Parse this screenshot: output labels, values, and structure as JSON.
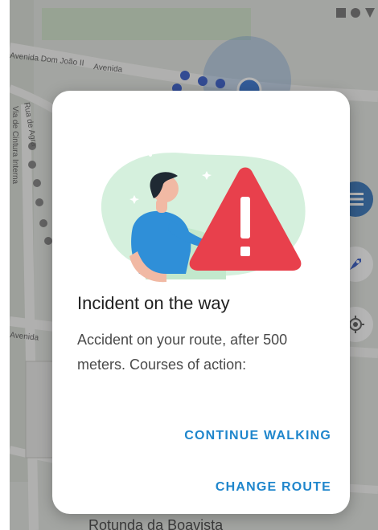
{
  "map": {
    "streets": [
      "Avenida Dom João II",
      "Avenida",
      "Rua de Agra",
      "Via de Cintura Interna",
      "Avenida"
    ],
    "place_label": "Rotunda da Boavista"
  },
  "status_bar": {
    "icons": [
      "signal-square-icon",
      "battery-dot-icon",
      "wifi-triangle-icon"
    ]
  },
  "map_controls": [
    "menu-icon",
    "rocket-icon",
    "locate-icon"
  ],
  "dialog": {
    "title": "Incident on the way",
    "body": "Accident on your route, after 500 meters. Courses of action:",
    "actions": {
      "continue": "CONTINUE WALKING",
      "change": "CHANGE ROUTE"
    }
  },
  "colors": {
    "accent": "#1f86cc",
    "warning": "#e8404c",
    "blob": "#d5f0dd",
    "person_shirt": "#2f8fd8"
  }
}
